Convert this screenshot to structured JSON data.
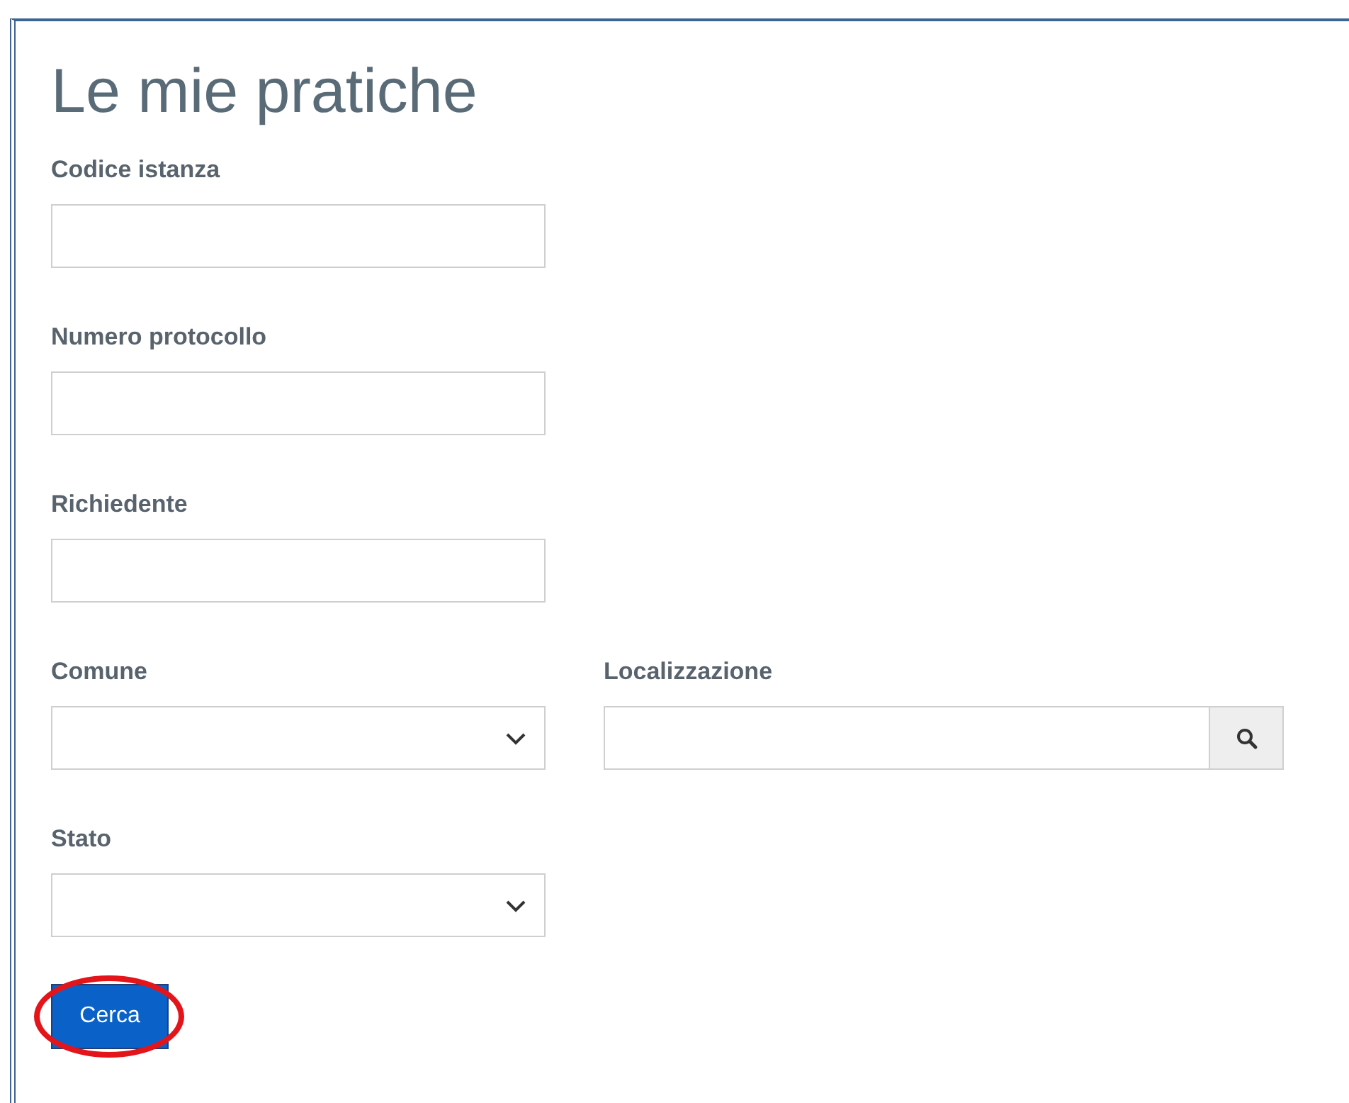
{
  "title": "Le mie pratiche",
  "rows": [
    {
      "fields": [
        {
          "kind": "text",
          "label": "Codice istanza"
        }
      ]
    },
    {
      "fields": [
        {
          "kind": "text",
          "label": "Numero protocollo"
        }
      ]
    },
    {
      "fields": [
        {
          "kind": "text",
          "label": "Richiedente"
        }
      ]
    },
    {
      "fields": [
        {
          "kind": "select",
          "label": "Comune"
        },
        {
          "kind": "search",
          "label": "Localizzazione"
        }
      ]
    },
    {
      "fields": [
        {
          "kind": "select",
          "label": "Stato"
        }
      ]
    }
  ],
  "button": {
    "label": "Cerca",
    "highlighted": true
  }
}
